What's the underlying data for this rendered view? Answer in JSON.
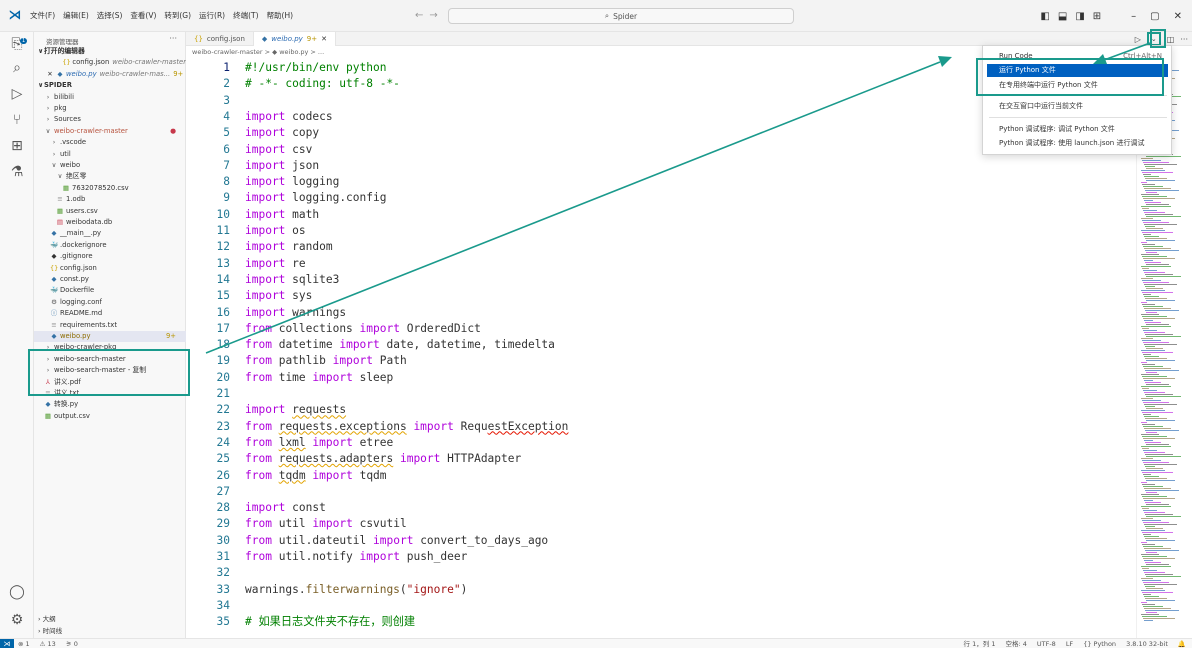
{
  "titlebar": {
    "menu": [
      "文件(F)",
      "编辑(E)",
      "选择(S)",
      "查看(V)",
      "转到(G)",
      "运行(R)",
      "终端(T)",
      "帮助(H)"
    ],
    "search_text": "Spider"
  },
  "activity_badge": "1",
  "sidebar": {
    "title": "资源管理器",
    "open_editors_label": "打开的编辑器",
    "open_editors": [
      {
        "name": "config.json",
        "detail": "weibo-crawler-master"
      },
      {
        "name": "weibo.py",
        "detail": "weibo-crawler-mas...",
        "mod": "9+"
      }
    ],
    "workspace_label": "SPIDER",
    "tree": [
      {
        "label": "bilibili",
        "type": "folder-closed",
        "indent": 1
      },
      {
        "label": "pkg",
        "type": "folder-closed",
        "indent": 1
      },
      {
        "label": "Sources",
        "type": "folder-closed",
        "indent": 1
      },
      {
        "label": "weibo-crawler-master",
        "type": "folder-open",
        "indent": 1,
        "dot": true
      },
      {
        "label": ".vscode",
        "type": "folder-closed",
        "indent": 2
      },
      {
        "label": "util",
        "type": "folder-closed",
        "indent": 2
      },
      {
        "label": "weibo",
        "type": "folder-open",
        "indent": 2
      },
      {
        "label": "绝区零",
        "type": "folder-open",
        "indent": 3
      },
      {
        "label": "7632078520.csv",
        "type": "csv",
        "indent": 4
      },
      {
        "label": "1.odb",
        "type": "file",
        "indent": 3
      },
      {
        "label": "users.csv",
        "type": "csv",
        "indent": 3
      },
      {
        "label": "weibodata.db",
        "type": "db",
        "indent": 3
      },
      {
        "label": "__main__.py",
        "type": "py",
        "indent": 2
      },
      {
        "label": ".dockerignore",
        "type": "docker",
        "indent": 2
      },
      {
        "label": ".gitignore",
        "type": "git",
        "indent": 2
      },
      {
        "label": "config.json",
        "type": "json",
        "indent": 2
      },
      {
        "label": "const.py",
        "type": "py",
        "indent": 2
      },
      {
        "label": "Dockerfile",
        "type": "docker",
        "indent": 2
      },
      {
        "label": "logging.conf",
        "type": "gear",
        "indent": 2
      },
      {
        "label": "README.md",
        "type": "md",
        "indent": 2
      },
      {
        "label": "requirements.txt",
        "type": "file",
        "indent": 2
      },
      {
        "label": "weibo.py",
        "type": "py",
        "indent": 2,
        "active": true,
        "mod": "9+"
      },
      {
        "label": "weibo-crawler-pkg",
        "type": "folder-closed",
        "indent": 1
      },
      {
        "label": "weibo-search-master",
        "type": "folder-closed",
        "indent": 1
      },
      {
        "label": "weibo-search-master - 复制",
        "type": "folder-closed",
        "indent": 1
      },
      {
        "label": "讲义.pdf",
        "type": "pdf",
        "indent": 1
      },
      {
        "label": "讲义.txt",
        "type": "file",
        "indent": 1
      },
      {
        "label": "转换.py",
        "type": "py",
        "indent": 1
      },
      {
        "label": "output.csv",
        "type": "csv",
        "indent": 1
      }
    ],
    "outline_label": "大纲",
    "timeline_label": "时间线"
  },
  "tabs": [
    {
      "name": "config.json",
      "kind": "json"
    },
    {
      "name": "weibo.py",
      "kind": "py",
      "mod": "9+",
      "active": true
    }
  ],
  "breadcrumb": "weibo-crawler-master > ◆ weibo.py > ...",
  "code_lines": [
    [
      [
        "cm",
        "#!/usr/bin/env python"
      ]
    ],
    [
      [
        "cm",
        "# -*- coding: utf-8 -*-"
      ]
    ],
    [],
    [
      [
        "kw",
        "import"
      ],
      [
        "",
        "codecs"
      ]
    ],
    [
      [
        "kw",
        "import"
      ],
      [
        "",
        "copy"
      ]
    ],
    [
      [
        "kw",
        "import"
      ],
      [
        "",
        "csv"
      ]
    ],
    [
      [
        "kw",
        "import"
      ],
      [
        "",
        "json"
      ]
    ],
    [
      [
        "kw",
        "import"
      ],
      [
        "",
        "logging"
      ]
    ],
    [
      [
        "kw",
        "import"
      ],
      [
        "",
        "logging.config"
      ]
    ],
    [
      [
        "kw",
        "import"
      ],
      [
        "",
        "math"
      ]
    ],
    [
      [
        "kw",
        "import"
      ],
      [
        "",
        "os"
      ]
    ],
    [
      [
        "kw",
        "import"
      ],
      [
        "",
        "random"
      ]
    ],
    [
      [
        "kw",
        "import"
      ],
      [
        "",
        "re"
      ]
    ],
    [
      [
        "kw",
        "import"
      ],
      [
        "",
        "sqlite3"
      ]
    ],
    [
      [
        "kw",
        "import"
      ],
      [
        "",
        "sys"
      ]
    ],
    [
      [
        "kw",
        "import"
      ],
      [
        "",
        "warnings"
      ]
    ],
    [
      [
        "kw",
        "from"
      ],
      [
        "",
        "collections"
      ],
      [
        "kw",
        "import"
      ],
      [
        "",
        "OrderedDict"
      ]
    ],
    [
      [
        "kw",
        "from"
      ],
      [
        "",
        "datetime"
      ],
      [
        "kw",
        "import"
      ],
      [
        "",
        "date, datetime, timedelta"
      ]
    ],
    [
      [
        "kw",
        "from"
      ],
      [
        "",
        "pathlib"
      ],
      [
        "kw",
        "import"
      ],
      [
        "",
        "Path"
      ]
    ],
    [
      [
        "kw",
        "from"
      ],
      [
        "",
        "time"
      ],
      [
        "kw",
        "import"
      ],
      [
        "",
        "sleep"
      ]
    ],
    [],
    [
      [
        "kw",
        "import"
      ],
      [
        "squig",
        "requests"
      ]
    ],
    [
      [
        "kw",
        "from"
      ],
      [
        "squig",
        "requests.exceptions"
      ],
      [
        "kw",
        "import"
      ],
      [
        "",
        "Requ"
      ],
      [
        "squig-red",
        "estException"
      ]
    ],
    [
      [
        "kw",
        "from"
      ],
      [
        "squig",
        "lxml"
      ],
      [
        "kw",
        "import"
      ],
      [
        "",
        "etree"
      ]
    ],
    [
      [
        "kw",
        "from"
      ],
      [
        "squig",
        "requests.adapters"
      ],
      [
        "kw",
        "import"
      ],
      [
        "",
        "HTTPAdapter"
      ]
    ],
    [
      [
        "kw",
        "from"
      ],
      [
        "squig",
        "tqdm"
      ],
      [
        "kw",
        "import"
      ],
      [
        "",
        "tqdm"
      ]
    ],
    [],
    [
      [
        "kw",
        "import"
      ],
      [
        "",
        "const"
      ]
    ],
    [
      [
        "kw",
        "from"
      ],
      [
        "",
        "util"
      ],
      [
        "kw",
        "import"
      ],
      [
        "",
        "csvutil"
      ]
    ],
    [
      [
        "kw",
        "from"
      ],
      [
        "",
        "util.dateutil"
      ],
      [
        "kw",
        "import"
      ],
      [
        "",
        "convert_to_days_ago"
      ]
    ],
    [
      [
        "kw",
        "from"
      ],
      [
        "",
        "util.notify"
      ],
      [
        "kw",
        "import"
      ],
      [
        "",
        "push_deer"
      ]
    ],
    [],
    [
      [
        "",
        "warnings."
      ],
      [
        "fn",
        "filterwarnings"
      ],
      [
        "",
        "("
      ],
      [
        "str",
        "\"ignore\""
      ],
      [
        "",
        ")"
      ]
    ],
    [],
    [
      [
        "cm",
        "# 如果日志文件夹不存在，则创建"
      ]
    ]
  ],
  "context_menu": {
    "items": [
      {
        "label": "Run Code",
        "shortcut": "Ctrl+Alt+N"
      },
      {
        "label": "运行 Python 文件",
        "selected": true
      },
      {
        "label": "在专用终端中运行 Python 文件"
      },
      {
        "label": "在交互窗口中运行当前文件"
      },
      {
        "label": "Python 调试程序: 调试 Python 文件"
      },
      {
        "label": "Python 调试程序: 使用 launch.json 进行调试"
      }
    ]
  },
  "statusbar": {
    "errors": "⊗ 1",
    "warnings": "⚠ 13",
    "ports": "⚞ 0",
    "position": "行 1，列 1",
    "spaces": "空格: 4",
    "encoding": "UTF-8",
    "eol": "LF",
    "language": "{} Python",
    "interpreter": "3.8.10 32-bit",
    "bell": "🔔"
  },
  "colors": {
    "annotation": "#1a9a8c",
    "selection": "#0060c0",
    "keyword": "#af00db",
    "comment": "#008000"
  }
}
